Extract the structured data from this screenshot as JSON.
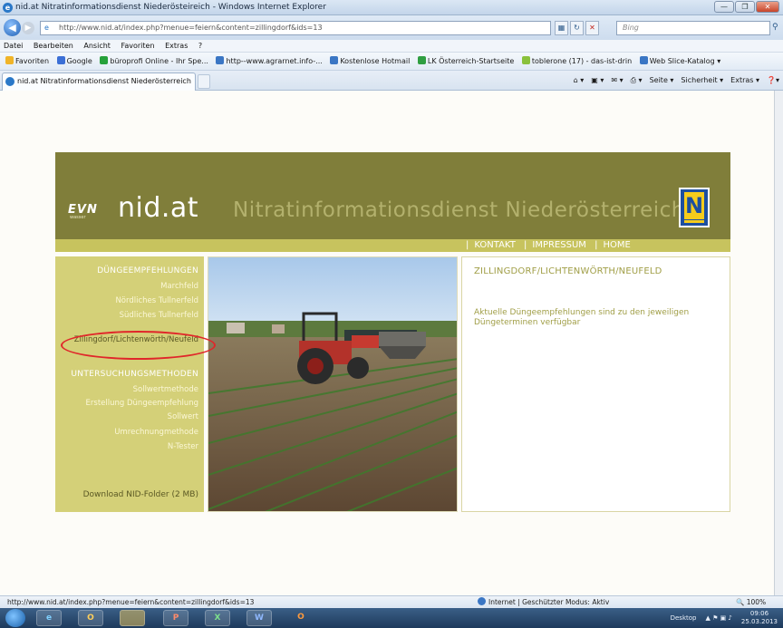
{
  "window": {
    "title": "nid.at Nitratinformationsdienst Niederösteireich - Windows Internet Explorer",
    "buttons": [
      "—",
      "❐",
      "✕"
    ]
  },
  "address": {
    "url": "http://www.nid.at/index.php?menue=feiern&content=zillingdorf&ids=13",
    "search_placeholder": "Bing"
  },
  "menubar": [
    "Datei",
    "Bearbeiten",
    "Ansicht",
    "Favoriten",
    "Extras",
    "?"
  ],
  "favorites": {
    "label": "Favoriten",
    "items": [
      {
        "label": "Google",
        "color": "#3b6fd6"
      },
      {
        "label": "büroprofi Online - Ihr Spe...",
        "color": "#26a13b"
      },
      {
        "label": "http--www.agrarnet.info-...",
        "color": "#3a76c4"
      },
      {
        "label": "Kostenlose Hotmail",
        "color": "#3a76c4"
      },
      {
        "label": "LK Österreich-Startseite",
        "color": "#2f9e41"
      },
      {
        "label": "toblerone (17) - das-ist-drin",
        "color": "#8ac13b"
      },
      {
        "label": "Web Slice-Katalog ▾",
        "color": "#3a76c4"
      }
    ]
  },
  "tab": {
    "label": "nid.at Nitratinformationsdienst Niederösterreich"
  },
  "commandbar": [
    "Seite ▾",
    "Sicherheit ▾",
    "Extras ▾"
  ],
  "site": {
    "evn_logo": "EVN",
    "evn_small": "wasser",
    "brand": "nid.at",
    "tagline": "Nitratinformationsdienst Niederösterreich",
    "nav": [
      "KONTAKT",
      "IMPRESSUM",
      "HOME"
    ],
    "sidebar": {
      "section1": "DÜNGEEMPFEHLUNGEN",
      "section1_items": [
        "Marchfeld",
        "Nördliches Tullnerfeld",
        "Südliches Tullnerfeld",
        "Zillingdorf/Lichtenwörth/Neufeld"
      ],
      "section2": "UNTERSUCHUNGSMETHODEN",
      "section2_items": [
        "Sollwertmethode",
        "Erstellung Düngeempfehlung",
        "Sollwert",
        "Umrechnungmethode",
        "N-Tester"
      ],
      "download": "Download NID-Folder (2 MB)"
    },
    "content": {
      "heading": "ZILLINGDORF/LICHTENWÖRTH/NEUFELD",
      "text": "Aktuelle Düngeempfehlungen sind zu den jeweiligen Düngeterminen verfügbar"
    }
  },
  "status": {
    "url": "http://www.nid.at/index.php?menue=feiern&content=zillingdorf&ids=13",
    "zone": "Internet | Geschützter Modus: Aktiv",
    "zoom": "100%"
  },
  "taskbar": {
    "apps": [
      "e",
      "O",
      "",
      "P",
      "X",
      "W",
      "O"
    ],
    "desktop": "Desktop",
    "time": "09:06",
    "date": "25.03.2013"
  }
}
